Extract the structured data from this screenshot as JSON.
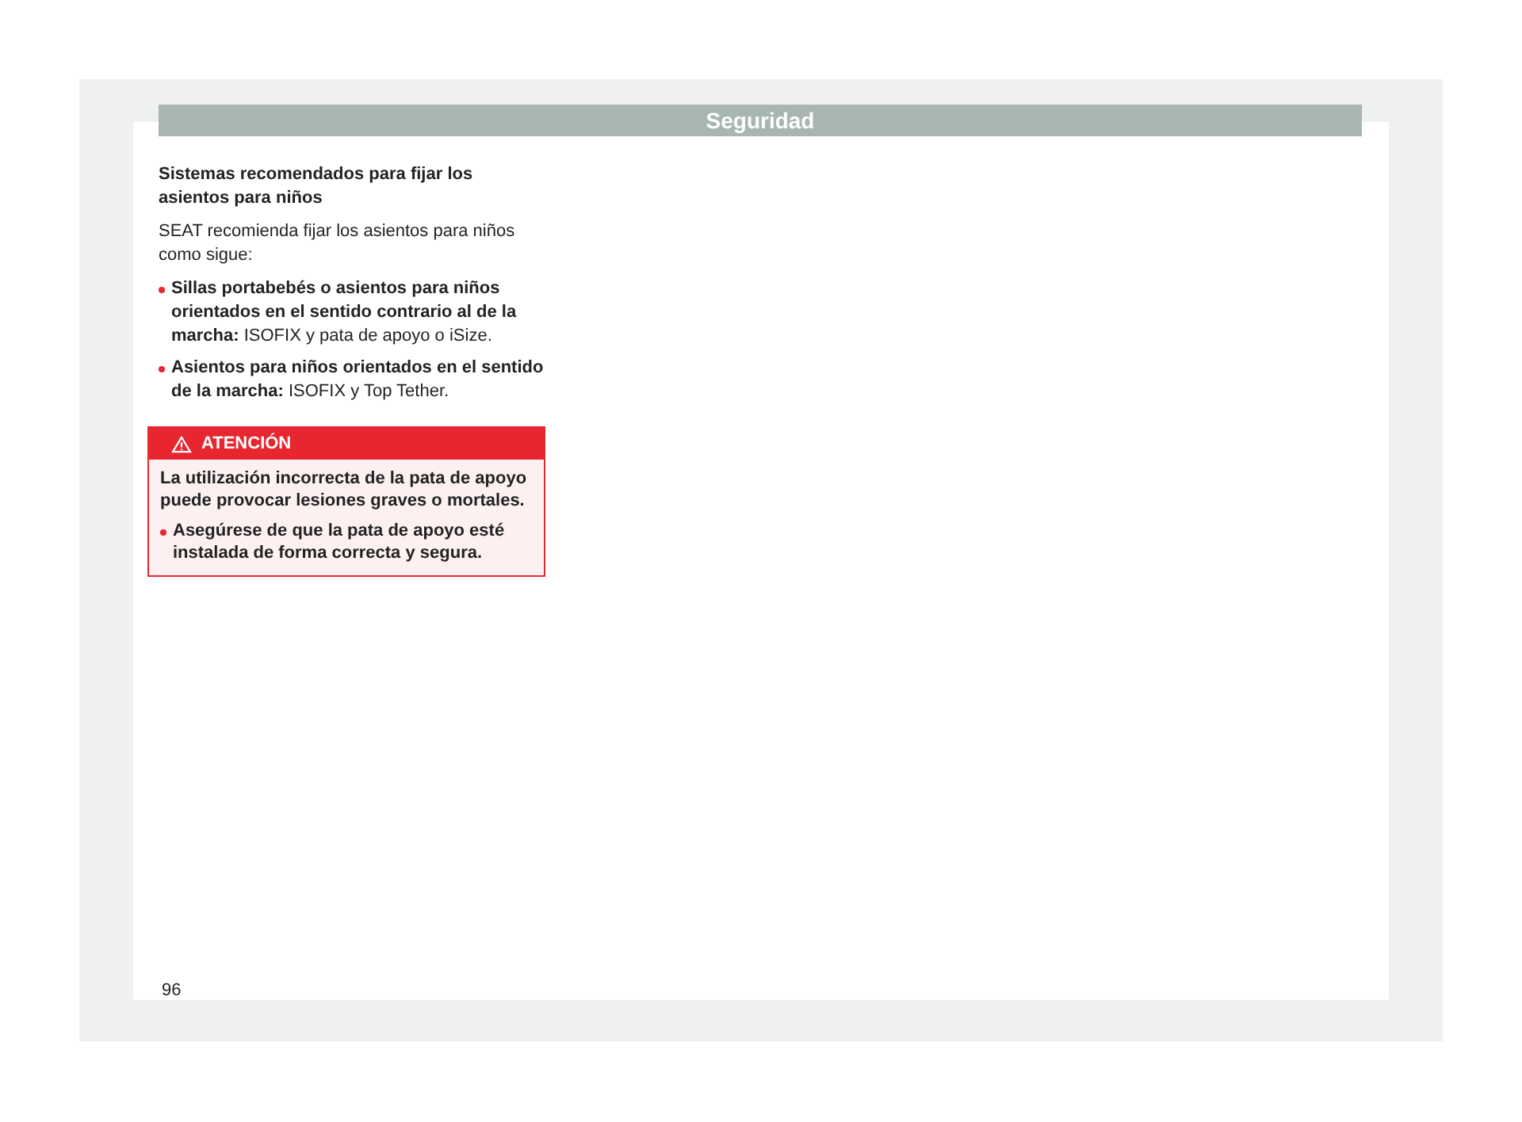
{
  "header": {
    "title": "Seguridad"
  },
  "section": {
    "heading": "Sistemas recomendados para fijar los asientos para niños",
    "intro": "SEAT recomienda fijar los asientos para niños como sigue:",
    "bullets": [
      "**Sillas portabebés o asientos para niños orientados en el sentido contrario al de la marcha:** ISOFIX y pata de apoyo o iSize.",
      "**Asientos para niños orientados en el sentido de la marcha:** ISOFIX y Top Tether."
    ]
  },
  "warning": {
    "title": "ATENCIÓN",
    "text": "La utilización incorrecta de la pata de apoyo puede provocar lesiones graves o mortales.",
    "bullets": [
      "Asegúrese de que la pata de apoyo esté instalada de forma correcta y segura."
    ]
  },
  "page_number": "96"
}
